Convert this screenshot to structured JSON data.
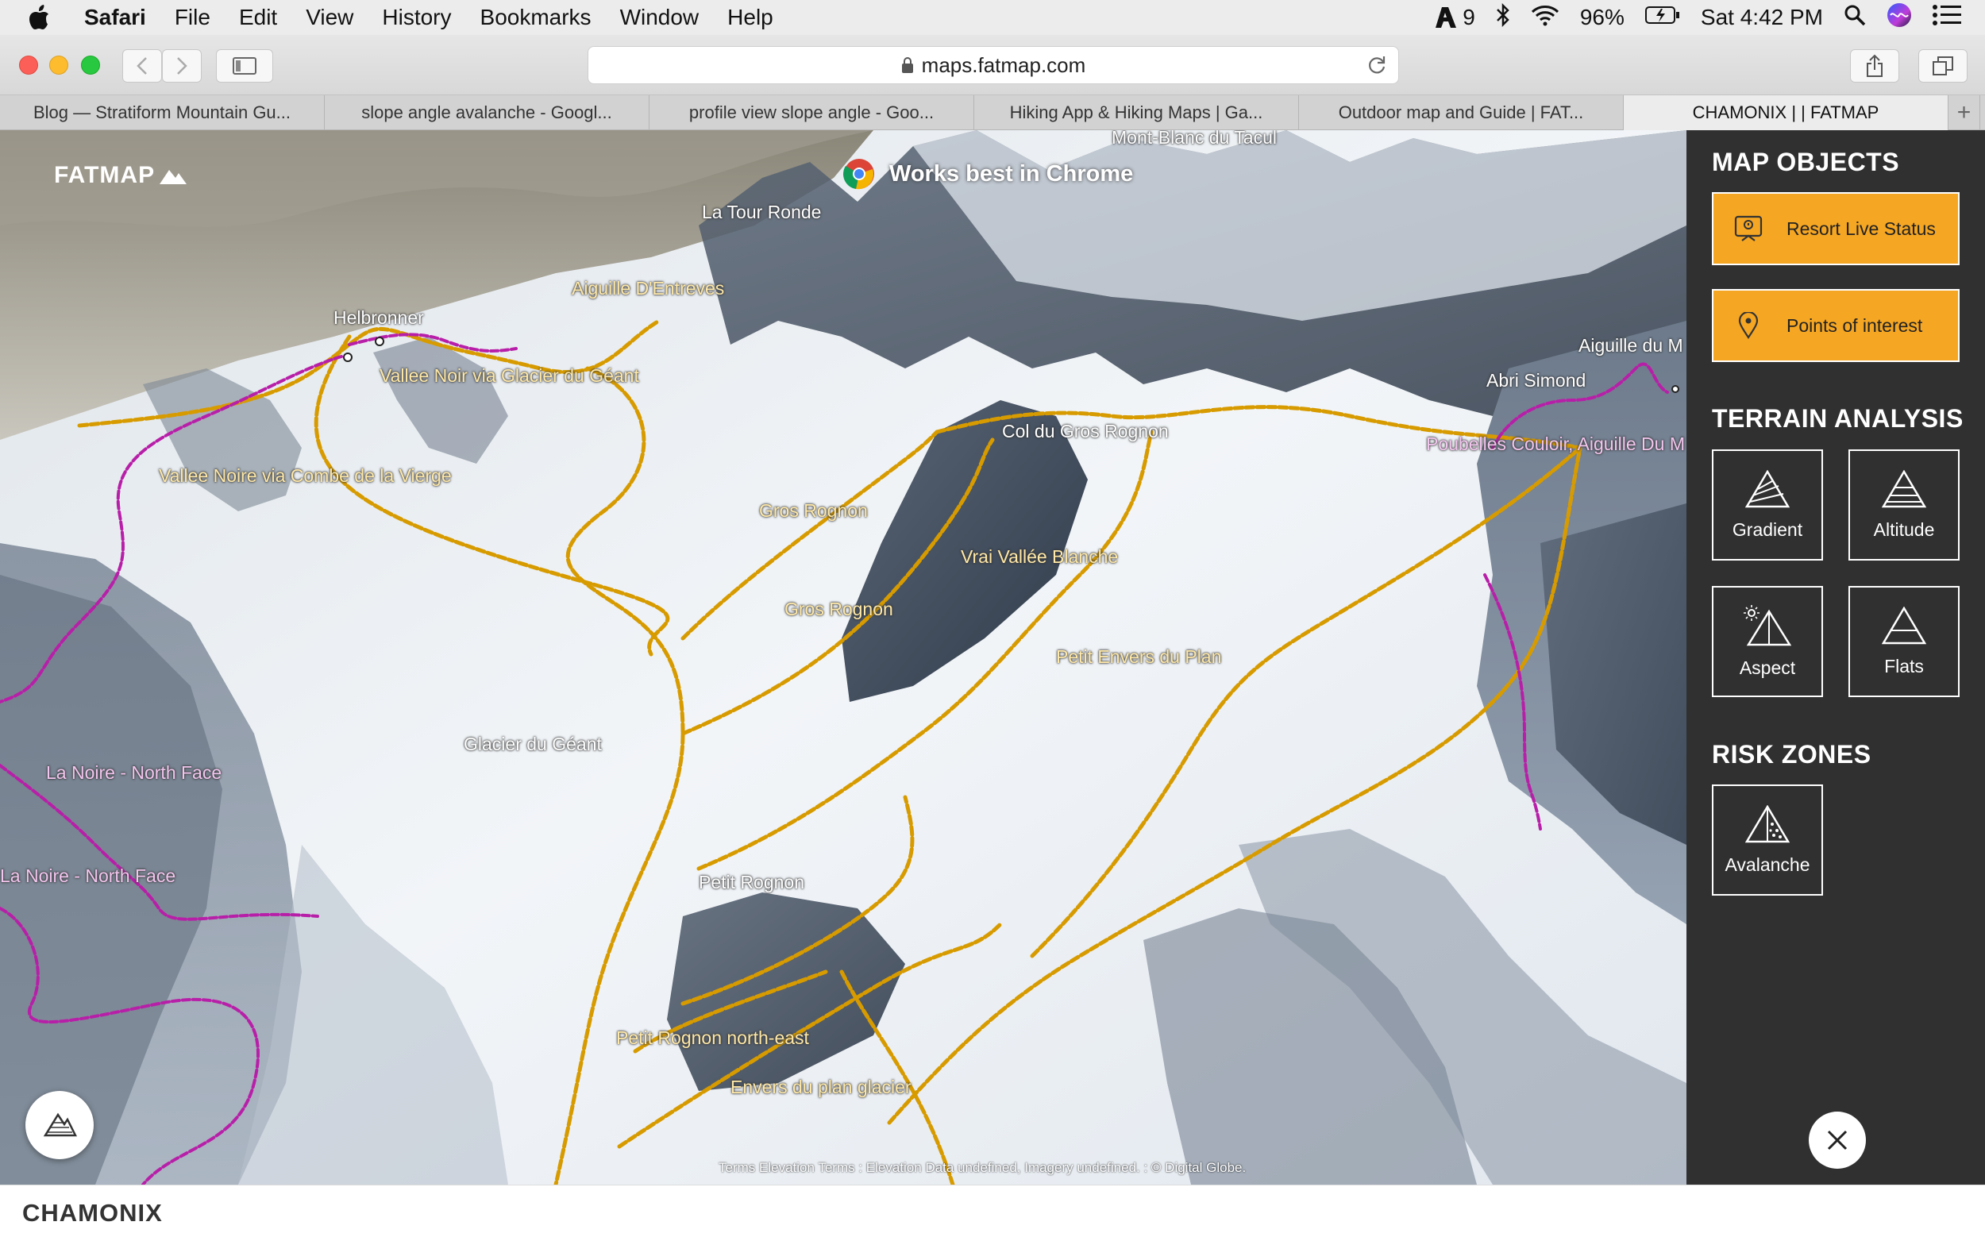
{
  "menubar": {
    "app_name": "Safari",
    "items": [
      "File",
      "Edit",
      "View",
      "History",
      "Bookmarks",
      "Window",
      "Help"
    ],
    "adobe_badge": "9",
    "battery": "96%",
    "clock": "Sat 4:42 PM"
  },
  "toolbar": {
    "url": "maps.fatmap.com"
  },
  "tabs": [
    {
      "label": "Blog — Stratiform Mountain Gu..."
    },
    {
      "label": "slope angle avalanche - Googl..."
    },
    {
      "label": "profile view slope angle - Goo..."
    },
    {
      "label": "Hiking App & Hiking Maps | Ga..."
    },
    {
      "label": "Outdoor map and Guide | FAT..."
    },
    {
      "label": "CHAMONIX | | FATMAP"
    }
  ],
  "map": {
    "logo": "FATMAP",
    "chrome_notice": "Works best in Chrome",
    "labels": {
      "mont_blanc_tacul": "Mont-Blanc du Tacul",
      "la_tour_ronde": "La Tour Ronde",
      "aiguille_dentreves": "Aiguille D'Entreves",
      "helbronner": "Helbronner",
      "vallee_noir_geant": "Vallee Noir via Glacier du Géant",
      "vallee_noire_vierge": "Vallee Noire via Combe de la Vierge",
      "col_du_gros_rognon": "Col du Gros Rognon",
      "gros_rognon_1": "Gros Rognon",
      "gros_rognon_2": "Gros Rognon",
      "vrai_vallee_blanche": "Vrai Vallée Blanche",
      "petit_envers_du_plan": "Petit Envers du Plan",
      "glacier_du_geant": "Glacier du Géant",
      "la_noire_nf_1": "La Noire - North Face",
      "la_noire_nf_2": "La Noire - North Face",
      "petit_rognon": "Petit Rognon",
      "petit_rognon_ne": "Petit Rognon north-east",
      "envers_du_plan_glacier": "Envers du plan glacier",
      "aiguille_du_m": "Aiguille du M",
      "abri_simond": "Abri Simond",
      "poubelles_couloir": "Poubelles Couloir, Aiguille Du M"
    },
    "attribution": "Terms  Elevation Terms : Elevation Data undefined, Imagery undefined. : © Digital Globe."
  },
  "panel": {
    "map_objects_heading": "MAP OBJECTS",
    "resort_live_status": "Resort Live Status",
    "points_of_interest": "Points of interest",
    "terrain_analysis_heading": "TERRAIN ANALYSIS",
    "gradient": "Gradient",
    "altitude": "Altitude",
    "aspect": "Aspect",
    "flats": "Flats",
    "risk_zones_heading": "RISK ZONES",
    "avalanche": "Avalanche",
    "accent_color": "#f5a623"
  },
  "footer": {
    "location": "CHAMONIX"
  }
}
